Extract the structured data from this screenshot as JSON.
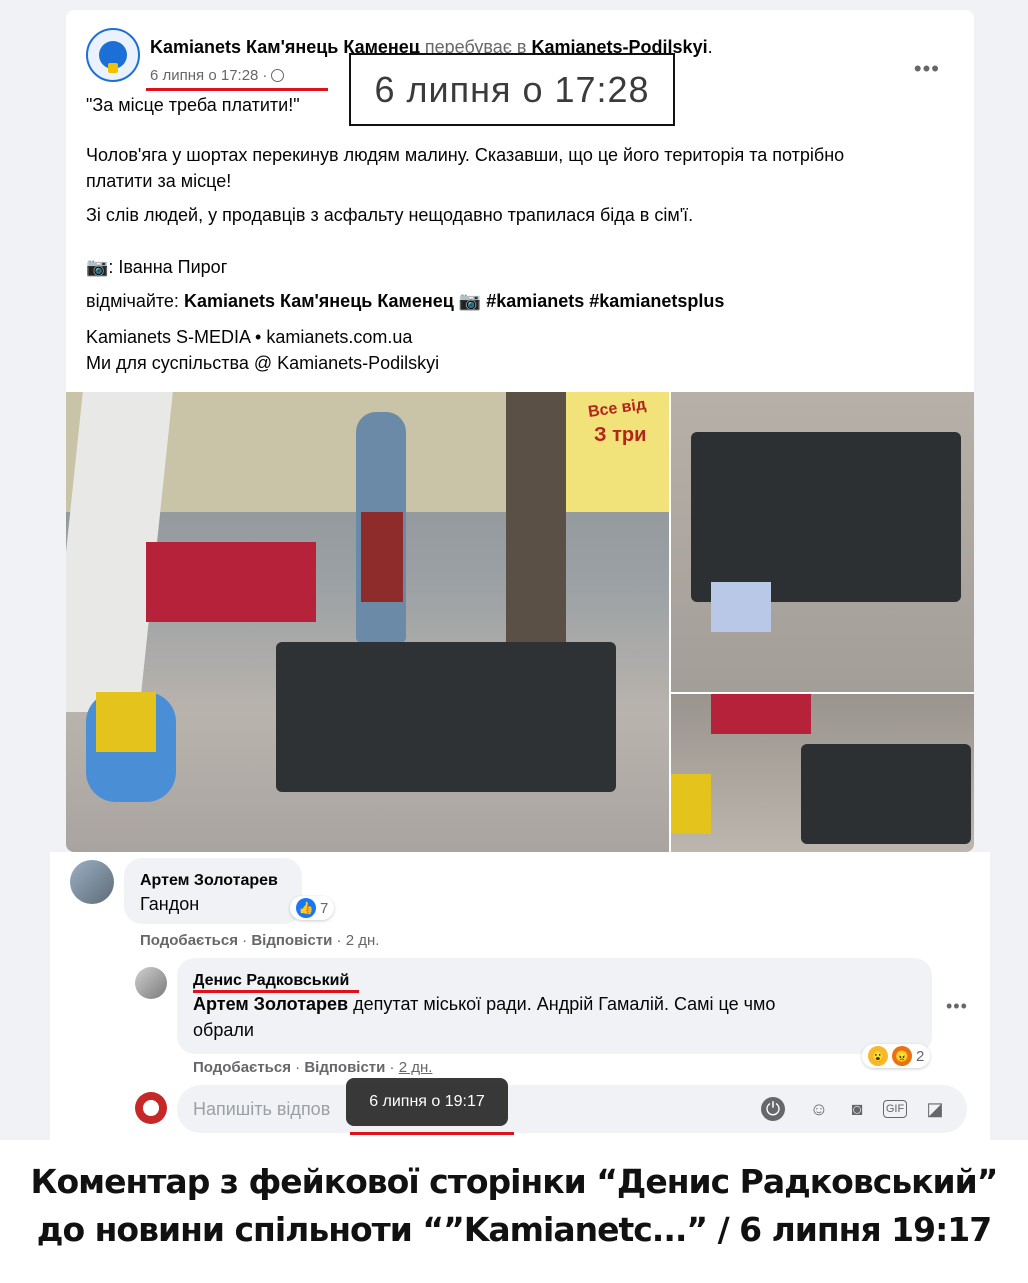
{
  "post": {
    "page_name": "Kamianets Кам'янець Каменец",
    "location_prefix": "перебуває в",
    "location": "Kamianets-Podilskyi",
    "location_suffix": ".",
    "timestamp": "6 липня о 17:28",
    "more_label": "•••",
    "zoom_timestamp": "6 липня о 17:28",
    "lines": {
      "quote": "\"За місце треба платити!\"",
      "p1a": "Чолов'яга у шортах перекинув людям малину. Сказавши, що це його територія та потрібно",
      "p1b": "платити за місце!",
      "p2": "Зі слів людей, у продавців з асфальту нещодавно трапилася біда в сім'ї.",
      "photo_credit": "📷: Іванна Пирог",
      "tag_prefix": "відмічайте:",
      "tag_page": "Kamianets Кам'янець Каменец 📷 #kamianets #kamianetsplus",
      "footer1": "Kamianets S-MEDIA • kamianets.com.ua",
      "footer2": "Ми для суспільства @ Kamianets-Podilskyi"
    },
    "photo_signs": {
      "kiosk_top": "Все від",
      "kiosk_bottom": "З три"
    }
  },
  "comments": [
    {
      "author": "Артем Золотарев",
      "text": "Гандон",
      "reactions": "7",
      "like": "Подобається",
      "reply": "Відповісти",
      "age": "2 дн."
    },
    {
      "author": "Денис Радковський",
      "mention": "Артем Золотарев",
      "text_line1": "депутат міської ради. Андрій Гамалій. Самі це чмо",
      "text_line2": "обрали",
      "reactions": "2",
      "like": "Подобається",
      "reply": "Відповісти",
      "age": "2 дн."
    }
  ],
  "reply_input": {
    "placeholder": "Напишіть відпов",
    "tooltip": "6 липня о 19:17"
  },
  "caption": {
    "line1": "Коментар з фейкової сторінки “Денис Радковський”",
    "line2": "до новини спільноти “”Kamianetc...” / 6 липня 19:17"
  },
  "colors": {
    "underline": "#e0111a",
    "facebook_blue": "#1877f2"
  }
}
